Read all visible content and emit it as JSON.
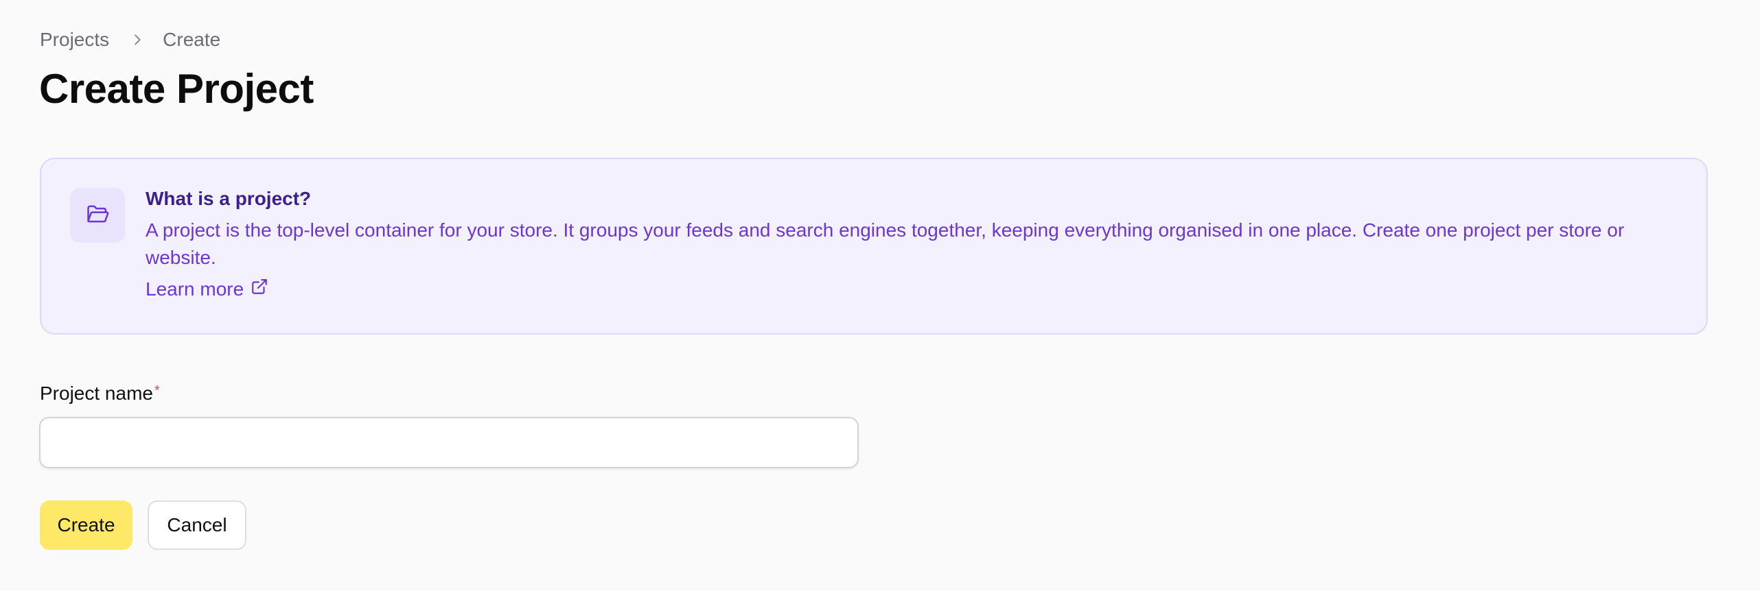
{
  "breadcrumb": {
    "items": [
      {
        "label": "Projects"
      },
      {
        "label": "Create"
      }
    ],
    "separator_icon": "chevron-right-icon"
  },
  "page": {
    "title": "Create Project"
  },
  "info_callout": {
    "icon": "folder-open-icon",
    "title": "What is a project?",
    "text": "A project is the top-level container for your store. It groups your feeds and search engines together, keeping everything organised in one place. Create one project per store or website.",
    "link_label": "Learn more",
    "link_icon": "external-link-icon"
  },
  "form": {
    "project_name": {
      "label": "Project name",
      "required_mark": "*",
      "value": "",
      "placeholder": ""
    }
  },
  "actions": {
    "create_label": "Create",
    "cancel_label": "Cancel"
  },
  "colors": {
    "background": "#fafafa",
    "callout_background": "#f4f1fe",
    "callout_border": "#ddd6fb",
    "callout_title": "#3b1f8f",
    "callout_text": "#6b36d6",
    "primary_button": "#fde868",
    "required": "#e5484d"
  }
}
